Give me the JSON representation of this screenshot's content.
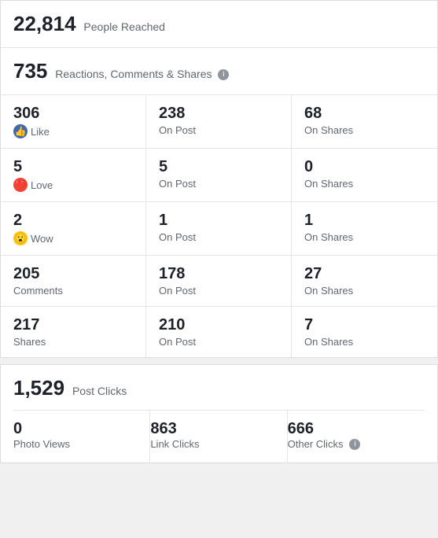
{
  "people_reached": {
    "number": "22,814",
    "label": "People Reached"
  },
  "reactions_summary": {
    "number": "735",
    "label": "Reactions, Comments & Shares"
  },
  "stats": [
    {
      "number": "306",
      "label": "Like",
      "icon": "like",
      "col2_number": "238",
      "col2_label": "On Post",
      "col3_number": "68",
      "col3_label": "On Shares"
    },
    {
      "number": "5",
      "label": "Love",
      "icon": "love",
      "col2_number": "5",
      "col2_label": "On Post",
      "col3_number": "0",
      "col3_label": "On Shares"
    },
    {
      "number": "2",
      "label": "Wow",
      "icon": "wow",
      "col2_number": "1",
      "col2_label": "On Post",
      "col3_number": "1",
      "col3_label": "On Shares"
    },
    {
      "number": "205",
      "label": "Comments",
      "icon": "none",
      "col2_number": "178",
      "col2_label": "On Post",
      "col3_number": "27",
      "col3_label": "On Shares"
    },
    {
      "number": "217",
      "label": "Shares",
      "icon": "none",
      "col2_number": "210",
      "col2_label": "On Post",
      "col3_number": "7",
      "col3_label": "On Shares"
    }
  ],
  "post_clicks": {
    "number": "1,529",
    "label": "Post Clicks",
    "items": [
      {
        "number": "0",
        "label": "Photo Views",
        "has_info": false
      },
      {
        "number": "863",
        "label": "Link Clicks",
        "has_info": false
      },
      {
        "number": "666",
        "label": "Other Clicks",
        "has_info": true
      }
    ]
  }
}
